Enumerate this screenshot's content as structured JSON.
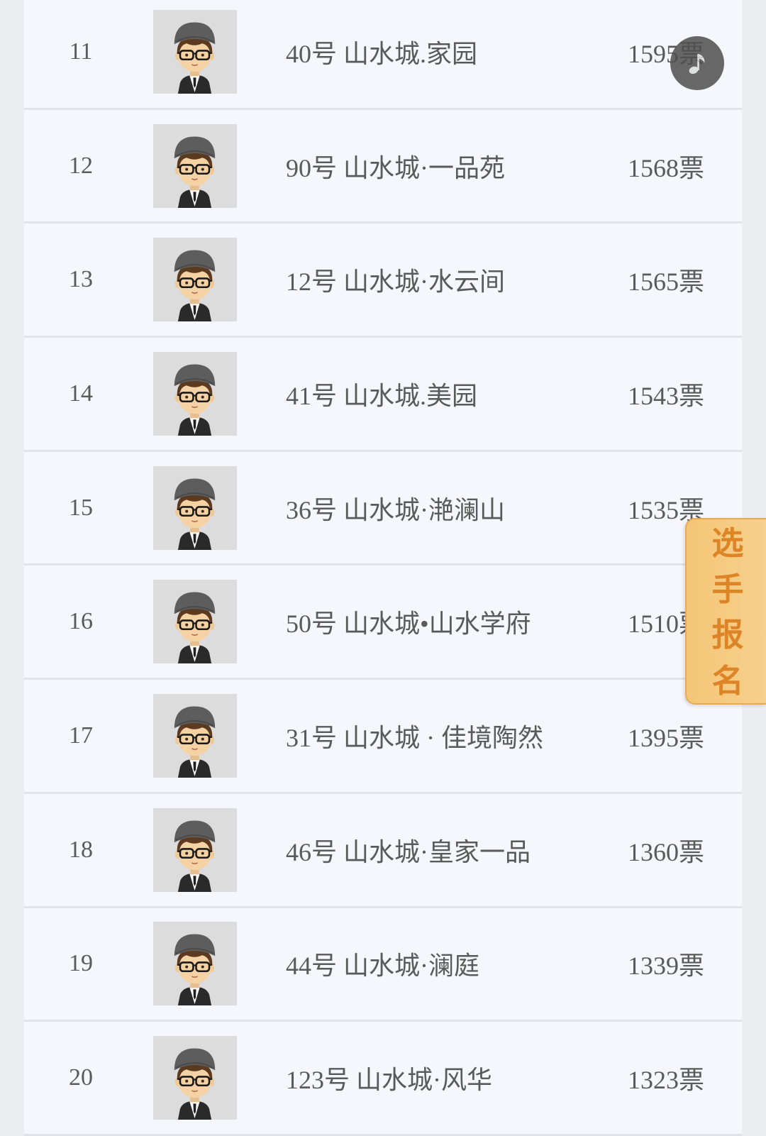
{
  "colors": {
    "page_bg": "#ebedf1",
    "row_bg": "#f5f7fd",
    "row_divider": "#e1e3ea",
    "text": "#5a5a5a",
    "music_button_bg": "#4f4f4f",
    "signup_tab_bg": "#f7d08d",
    "signup_tab_border": "#eaa852",
    "signup_tab_text": "#dd8426"
  },
  "row_avatar_icon": "user-avatar-icon",
  "rows": [
    {
      "rank": "11",
      "name": "40号 山水城.家园",
      "votes": "1595票"
    },
    {
      "rank": "12",
      "name": "90号 山水城·一品苑",
      "votes": "1568票"
    },
    {
      "rank": "13",
      "name": "12号 山水城·水云间",
      "votes": "1565票"
    },
    {
      "rank": "14",
      "name": "41号 山水城.美园",
      "votes": "1543票"
    },
    {
      "rank": "15",
      "name": "36号 山水城·滟澜山",
      "votes": "1535票"
    },
    {
      "rank": "16",
      "name": "50号 山水城•山水学府",
      "votes": "1510票"
    },
    {
      "rank": "17",
      "name": "31号 山水城 · 佳境陶然",
      "votes": "1395票"
    },
    {
      "rank": "18",
      "name": "46号 山水城·皇家一品",
      "votes": "1360票"
    },
    {
      "rank": "19",
      "name": "44号 山水城·澜庭",
      "votes": "1339票"
    },
    {
      "rank": "20",
      "name": "123号 山水城·风华",
      "votes": "1323票"
    }
  ],
  "music_button": {
    "icon": "music-note-icon"
  },
  "signup_tab": {
    "label": "选手报名"
  }
}
